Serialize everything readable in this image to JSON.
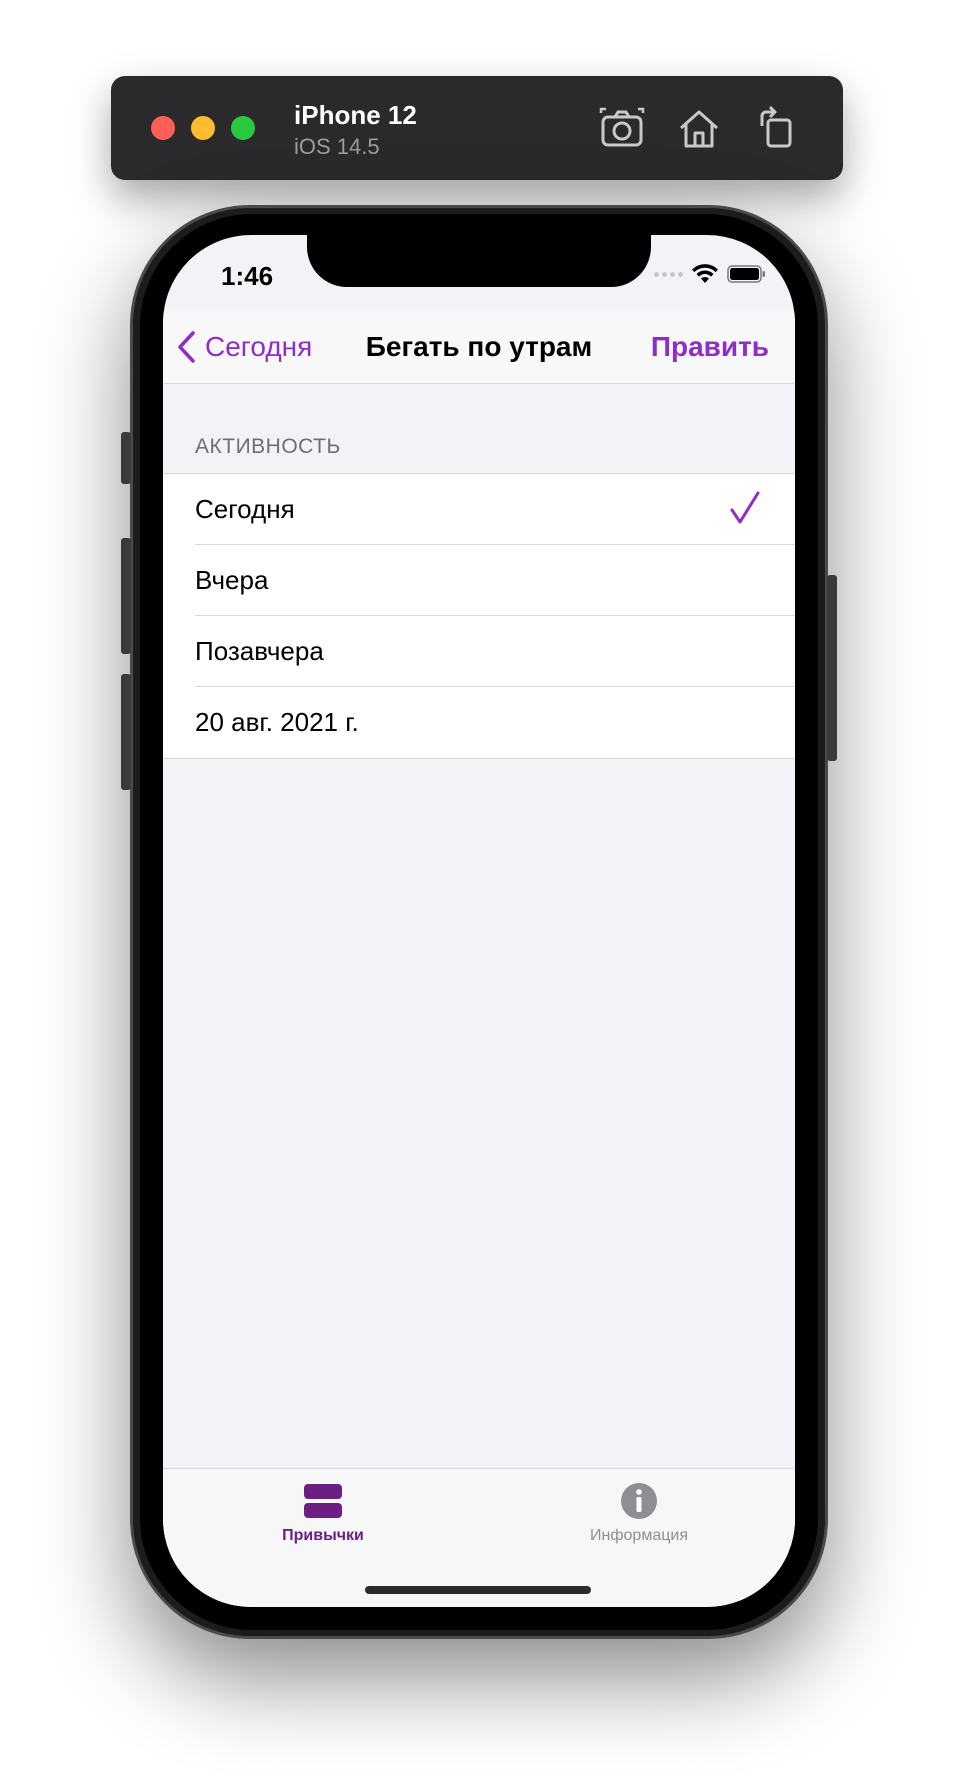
{
  "simulator": {
    "device_name": "iPhone 12",
    "os_version": "iOS 14.5",
    "toolbar_icons": [
      "screenshot-icon",
      "home-icon",
      "rotate-icon"
    ]
  },
  "status_bar": {
    "time": "1:46"
  },
  "nav": {
    "back_label": "Сегодня",
    "title": "Бегать по утрам",
    "edit_label": "Править"
  },
  "section": {
    "header": "АКТИВНОСТЬ",
    "rows": [
      {
        "label": "Сегодня",
        "checked": true
      },
      {
        "label": "Вчера",
        "checked": false
      },
      {
        "label": "Позавчера",
        "checked": false
      },
      {
        "label": "20 авг. 2021 г.",
        "checked": false
      }
    ]
  },
  "tabbar": {
    "tabs": [
      {
        "label": "Привычки",
        "icon": "stack-icon",
        "selected": true
      },
      {
        "label": "Информация",
        "icon": "info-icon",
        "selected": false
      }
    ]
  },
  "colors": {
    "accent": "#8e2ec6",
    "tab_selected": "#6b1f82",
    "tab_unselected": "#8e8e93",
    "grouped_background": "#f2f2f7"
  }
}
